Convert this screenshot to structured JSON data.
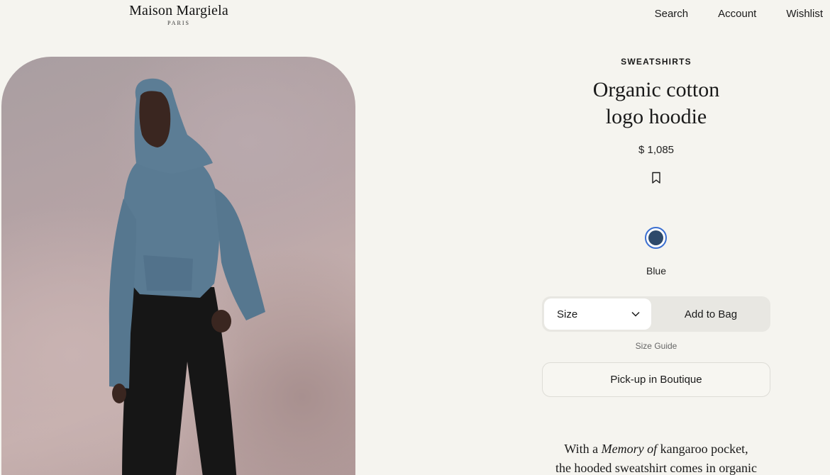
{
  "header": {
    "brand": "Maison Margiela",
    "brand_city": "PARIS",
    "nav": [
      "Search",
      "Account",
      "Wishlist"
    ]
  },
  "product": {
    "category": "SWEATSHIRTS",
    "title_line1": "Organic cotton",
    "title_line2": "logo hoodie",
    "price": "$ 1,085",
    "color_name": "Blue",
    "color_hex": "#2e4a6b",
    "size_label": "Size",
    "add_to_bag": "Add to Bag",
    "size_guide": "Size Guide",
    "pickup": "Pick-up in Boutique",
    "description_prefix": "With a ",
    "description_italic": "Memory of",
    "description_rest1": " kangaroo pocket,",
    "description_line2": "the hooded sweatshirt comes in organic"
  },
  "icons": {
    "bookmark": "bookmark-icon",
    "chevron": "chevron-down-icon"
  }
}
